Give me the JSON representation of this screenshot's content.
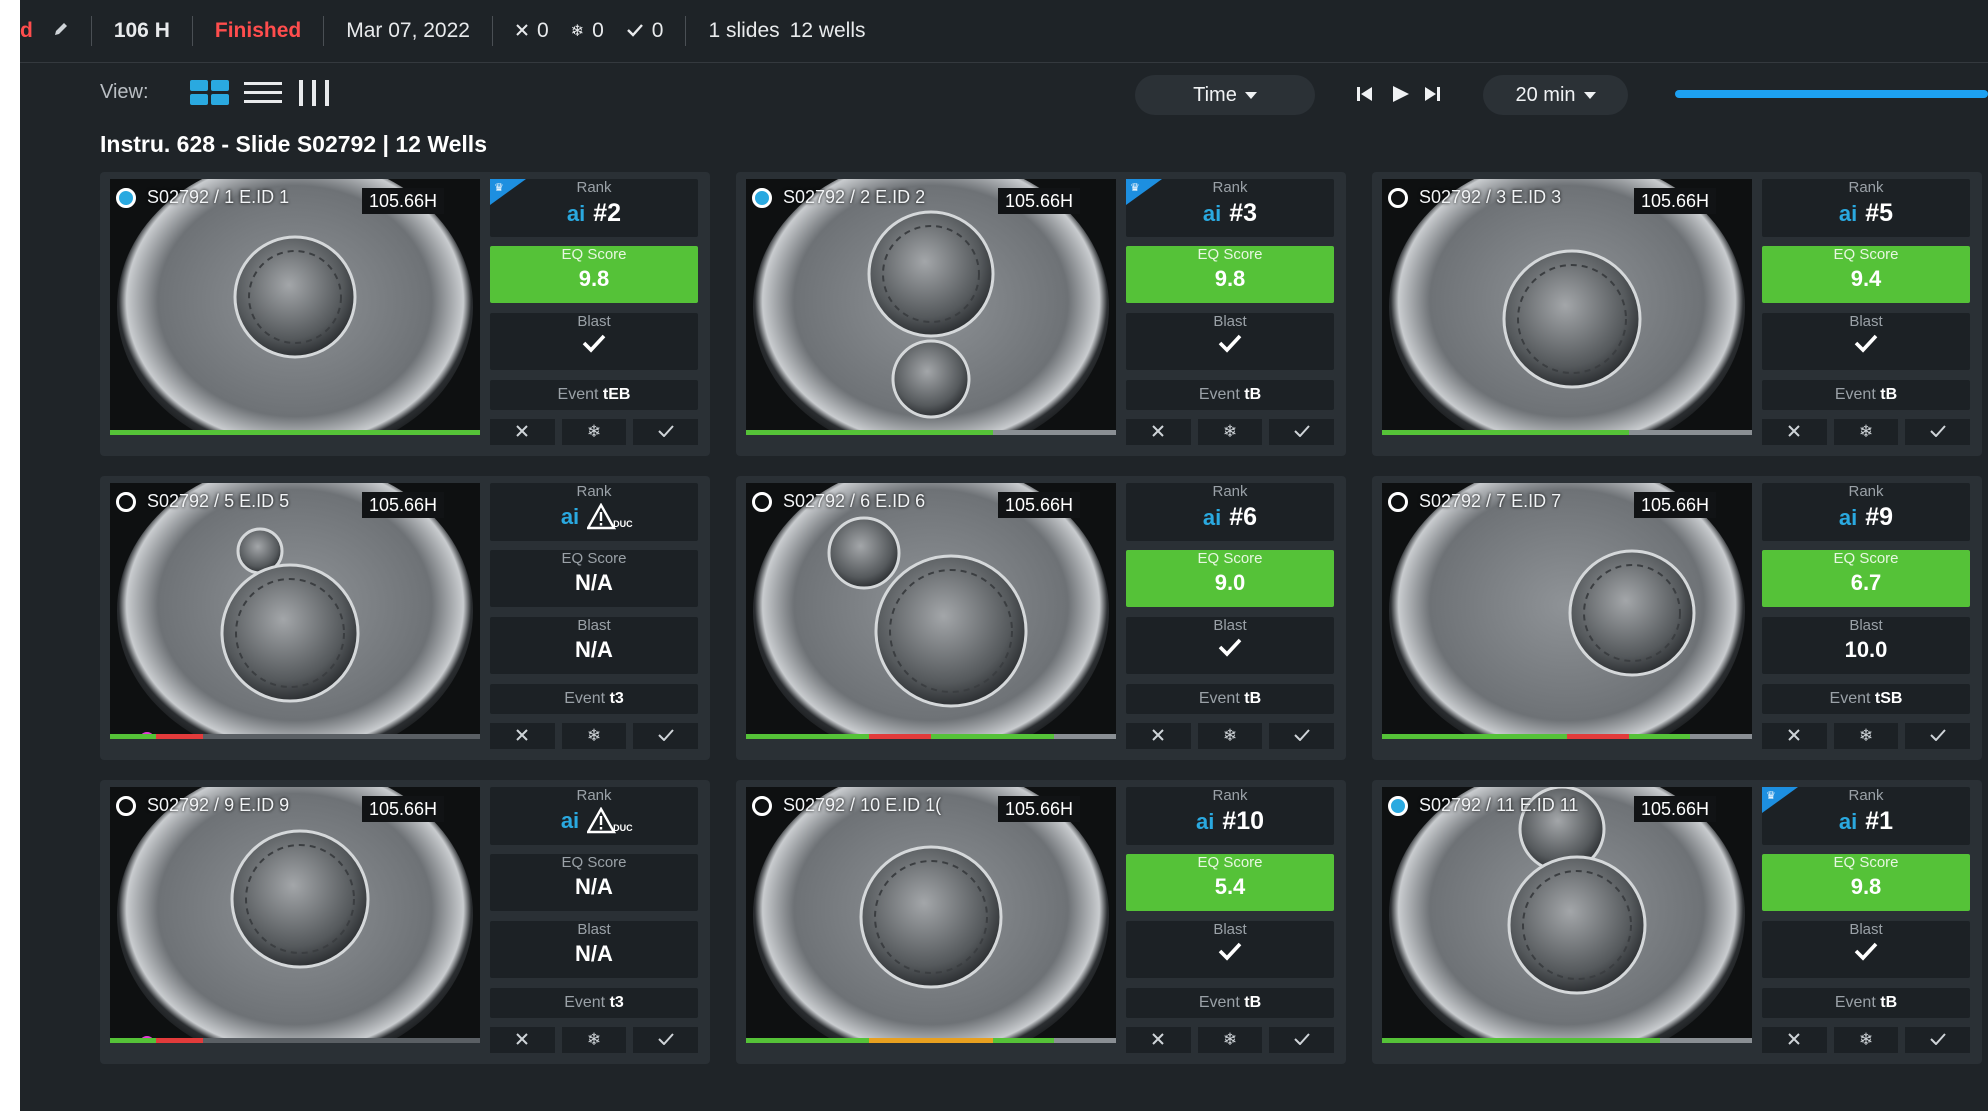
{
  "topbar": {
    "partial_label": "d",
    "edit_icon": "pencil-icon",
    "hours": "106 H",
    "status": "Finished",
    "date": "Mar 07, 2022",
    "counts": [
      {
        "icon": "cross-icon",
        "value": "0"
      },
      {
        "icon": "snowflake-icon",
        "value": "0"
      },
      {
        "icon": "check-icon",
        "value": "0"
      }
    ],
    "slides": "1 slides",
    "wells": "12 wells"
  },
  "viewbar": {
    "view_label": "View:",
    "time_dropdown": "Time",
    "interval_dropdown": "20 min",
    "playback": [
      "skip-back-icon",
      "play-icon",
      "skip-forward-icon"
    ],
    "timeline_progress": 1.0
  },
  "title": "Instru. 628 - Slide S02792 | 12 Wells",
  "labels": {
    "rank": "Rank",
    "eq_score": "EQ Score",
    "blast": "Blast",
    "event": "Event",
    "ai": "ai",
    "duc": "DUC"
  },
  "colors": {
    "accent_blue": "#2aa9e0",
    "score_green": "#55c238",
    "status_red": "#ff4d4d",
    "timelapse_pink": "#e23ad8"
  },
  "wells": [
    {
      "id": "S02792 / 1  E.ID 1",
      "time": "105.66H",
      "selected": true,
      "top": true,
      "rank": "#2",
      "eq": "9.8",
      "eq_green": true,
      "blast": "check",
      "event_val": "tEB",
      "timelapse": false
    },
    {
      "id": "S02792 / 2  E.ID 2",
      "time": "105.66H",
      "selected": true,
      "top": true,
      "rank": "#3",
      "eq": "9.8",
      "eq_green": true,
      "blast": "check",
      "event_val": "tB",
      "timelapse": false
    },
    {
      "id": "S02792 / 3  E.ID 3",
      "time": "105.66H",
      "selected": false,
      "top": false,
      "rank": "#5",
      "eq": "9.4",
      "eq_green": true,
      "blast": "check",
      "event_val": "tB",
      "timelapse": false
    },
    {
      "id": "S02792 / 5  E.ID 5",
      "time": "105.66H",
      "selected": false,
      "top": false,
      "rank": "duc",
      "eq": "N/A",
      "eq_green": false,
      "blast": "N/A",
      "event_val": "t3",
      "timelapse": true
    },
    {
      "id": "S02792 / 6  E.ID 6",
      "time": "105.66H",
      "selected": false,
      "top": false,
      "rank": "#6",
      "eq": "9.0",
      "eq_green": true,
      "blast": "check",
      "event_val": "tB",
      "timelapse": false
    },
    {
      "id": "S02792 / 7  E.ID 7",
      "time": "105.66H",
      "selected": false,
      "top": false,
      "rank": "#9",
      "eq": "6.7",
      "eq_green": true,
      "blast": "10.0",
      "event_val": "tSB",
      "timelapse": false
    },
    {
      "id": "S02792 / 9  E.ID 9",
      "time": "105.66H",
      "selected": false,
      "top": false,
      "rank": "duc",
      "eq": "N/A",
      "eq_green": false,
      "blast": "N/A",
      "event_val": "t3",
      "timelapse": true
    },
    {
      "id": "S02792 / 10  E.ID 1(",
      "time": "105.66H",
      "selected": false,
      "top": false,
      "rank": "#10",
      "eq": "5.4",
      "eq_green": true,
      "blast": "check",
      "event_val": "tB",
      "timelapse": false
    },
    {
      "id": "S02792 / 11  E.ID 11",
      "time": "105.66H",
      "selected": true,
      "top": true,
      "rank": "#1",
      "eq": "9.8",
      "eq_green": true,
      "blast": "check",
      "event_val": "tB",
      "timelapse": false
    }
  ]
}
